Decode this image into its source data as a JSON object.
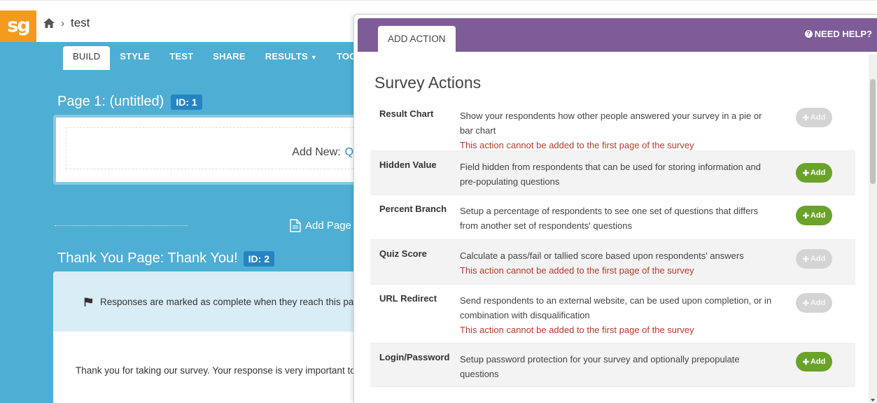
{
  "app": {
    "logo": "sg",
    "breadcrumb": "test"
  },
  "builder": {
    "tabs": [
      {
        "label": "BUILD"
      },
      {
        "label": "STYLE"
      },
      {
        "label": "TEST"
      },
      {
        "label": "SHARE"
      },
      {
        "label": "RESULTS"
      },
      {
        "label": "TOOLS"
      }
    ],
    "page1": {
      "title": "Page 1: (untitled)",
      "id_badge": "ID: 1",
      "add_new_label": "Add New:",
      "add_new_link": "Qu"
    },
    "add_page_label": "Add Page",
    "thank_you": {
      "title": "Thank You Page: Thank You!",
      "id_badge": "ID: 2",
      "note": "Responses are marked as complete when they reach this pa",
      "message": "Thank you for taking our survey. Your response is very important to"
    }
  },
  "modal": {
    "tab": "ADD ACTION",
    "help": "NEED HELP?",
    "title": "Survey Actions",
    "add_label": "Add",
    "actions": [
      {
        "name": "Result Chart",
        "desc": "Show your respondents how other people answered your survey in a pie or bar chart",
        "warning": "This action cannot be added to the first page of the survey",
        "enabled": false
      },
      {
        "name": "Hidden Value",
        "desc": "Field hidden from respondents that can be used for storing information and pre-populating questions",
        "warning": "",
        "enabled": true
      },
      {
        "name": "Percent Branch",
        "desc": "Setup a percentage of respondents to see one set of questions that differs from another set of respondents' questions",
        "warning": "",
        "enabled": true
      },
      {
        "name": "Quiz Score",
        "desc": "Calculate a pass/fail or tallied score based upon respondents' answers",
        "warning": "This action cannot be added to the first page of the survey",
        "enabled": false
      },
      {
        "name": "URL Redirect",
        "desc": "Send respondents to an external website, can be used upon completion, or in combination with disqualification",
        "warning": "This action cannot be added to the first page of the survey",
        "enabled": false
      },
      {
        "name": "Login/Password",
        "desc": "Setup password protection for your survey and optionally prepopulate questions",
        "warning": "",
        "enabled": true
      }
    ]
  },
  "colors": {
    "builder_bg": "#4faed4",
    "modal_header": "#7d5c98",
    "add_enabled": "#6aa22a",
    "add_disabled": "#d4d4d4",
    "warning": "#b43a2e",
    "logo": "#f29b1e"
  }
}
